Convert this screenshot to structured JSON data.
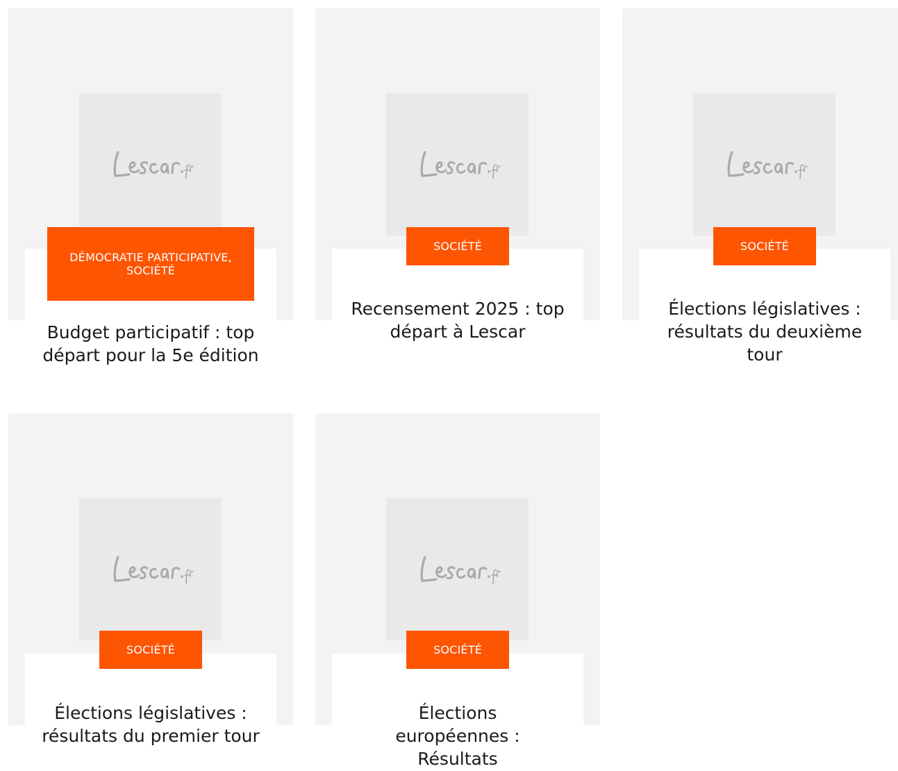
{
  "colors": {
    "accent": "#fe5503",
    "card_background": "#f3f3f3",
    "thumbnail_background": "#e9e9e9",
    "logo": "#a9a9a9"
  },
  "logo_text": "Lescar.fr",
  "articles": [
    {
      "category": "DÉMOCRATIE PARTICIPATIVE, SOCIÉTÉ",
      "title": "Budget participatif : top départ pour la 5e édition"
    },
    {
      "category": "SOCIÉTÉ",
      "title": "Recensement 2025 : top départ à Lescar"
    },
    {
      "category": "SOCIÉTÉ",
      "title": "Élections législatives : résultats du deuxième tour"
    },
    {
      "category": "SOCIÉTÉ",
      "title": "Élections législatives : résultats du premier tour"
    },
    {
      "category": "SOCIÉTÉ",
      "title": "Élections européennes : Résultats"
    }
  ]
}
